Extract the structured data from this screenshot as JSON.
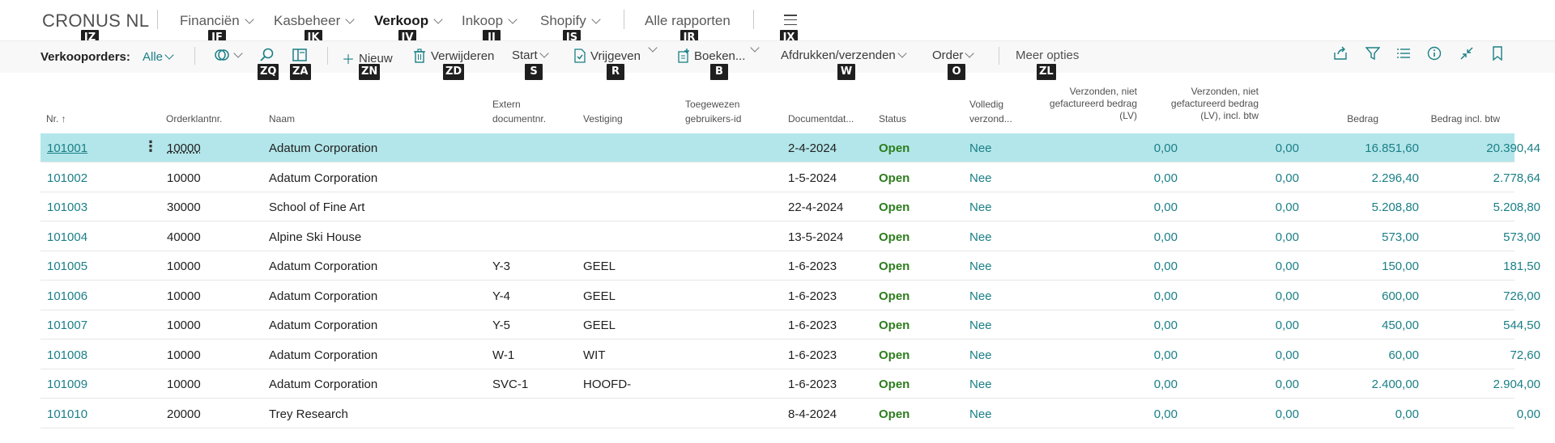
{
  "nav": {
    "company": "CRONUS NL",
    "items": [
      {
        "label": "Financiën",
        "chevron": true
      },
      {
        "label": "Kasbeheer",
        "chevron": true
      },
      {
        "label": "Verkoop",
        "chevron": true,
        "active": true
      },
      {
        "label": "Inkoop",
        "chevron": true
      },
      {
        "label": "Shopify",
        "chevron": true
      },
      {
        "label": "Alle rapporten",
        "chevron": false
      }
    ]
  },
  "keytips": {
    "company": "JZ",
    "financien": "JF",
    "kasbeheer": "JK",
    "verkoop": "JV",
    "inkoop": "JI",
    "shopify": "JS",
    "alle_rapporten": "JR",
    "menu": "JX",
    "search": "ZQ",
    "filter_pane": "ZA",
    "nieuw": "ZN",
    "verwijderen": "ZD",
    "start": "S",
    "vrijgeven": "R",
    "boeken": "B",
    "afdrukken": "W",
    "order": "O",
    "meer": "ZL"
  },
  "actions": {
    "page_title": "Verkooporders:",
    "view": "Alle",
    "nieuw": "Nieuw",
    "verwijderen": "Verwijderen",
    "start": "Start",
    "vrijgeven": "Vrijgeven",
    "boeken": "Boeken...",
    "afdrukken": "Afdrukken/verzenden",
    "order": "Order",
    "meer": "Meer opties"
  },
  "columns": {
    "nr": "Nr. ↑",
    "klant": "Orderklantnr.",
    "naam": "Naam",
    "extern": [
      "Extern",
      "documentnr."
    ],
    "vestiging": "Vestiging",
    "gebruiker": [
      "Toegewezen",
      "gebruikers-id"
    ],
    "datum": "Documentdat...",
    "status": "Status",
    "volledig": [
      "Volledig",
      "verzond..."
    ],
    "verzonden": [
      "Verzonden, niet",
      "gefactureerd bedrag",
      "(LV)"
    ],
    "verzonden_btw": [
      "Verzonden, niet",
      "gefactureerd bedrag",
      "(LV), incl. btw"
    ],
    "bedrag": "Bedrag",
    "bedrag_btw": "Bedrag incl. btw"
  },
  "rows": [
    {
      "nr": "101001",
      "klant": "10000",
      "naam": "Adatum Corporation",
      "extern": "",
      "vestiging": "",
      "datum": "2-4-2024",
      "status": "Open",
      "volledig": "Nee",
      "verz": "0,00",
      "verz_btw": "0,00",
      "bedrag": "16.851,60",
      "bedrag_btw": "20.390,44"
    },
    {
      "nr": "101002",
      "klant": "10000",
      "naam": "Adatum Corporation",
      "extern": "",
      "vestiging": "",
      "datum": "1-5-2024",
      "status": "Open",
      "volledig": "Nee",
      "verz": "0,00",
      "verz_btw": "0,00",
      "bedrag": "2.296,40",
      "bedrag_btw": "2.778,64"
    },
    {
      "nr": "101003",
      "klant": "30000",
      "naam": "School of Fine Art",
      "extern": "",
      "vestiging": "",
      "datum": "22-4-2024",
      "status": "Open",
      "volledig": "Nee",
      "verz": "0,00",
      "verz_btw": "0,00",
      "bedrag": "5.208,80",
      "bedrag_btw": "5.208,80"
    },
    {
      "nr": "101004",
      "klant": "40000",
      "naam": "Alpine Ski House",
      "extern": "",
      "vestiging": "",
      "datum": "13-5-2024",
      "status": "Open",
      "volledig": "Nee",
      "verz": "0,00",
      "verz_btw": "0,00",
      "bedrag": "573,00",
      "bedrag_btw": "573,00"
    },
    {
      "nr": "101005",
      "klant": "10000",
      "naam": "Adatum Corporation",
      "extern": "Y-3",
      "vestiging": "GEEL",
      "datum": "1-6-2023",
      "status": "Open",
      "volledig": "Nee",
      "verz": "0,00",
      "verz_btw": "0,00",
      "bedrag": "150,00",
      "bedrag_btw": "181,50"
    },
    {
      "nr": "101006",
      "klant": "10000",
      "naam": "Adatum Corporation",
      "extern": "Y-4",
      "vestiging": "GEEL",
      "datum": "1-6-2023",
      "status": "Open",
      "volledig": "Nee",
      "verz": "0,00",
      "verz_btw": "0,00",
      "bedrag": "600,00",
      "bedrag_btw": "726,00"
    },
    {
      "nr": "101007",
      "klant": "10000",
      "naam": "Adatum Corporation",
      "extern": "Y-5",
      "vestiging": "GEEL",
      "datum": "1-6-2023",
      "status": "Open",
      "volledig": "Nee",
      "verz": "0,00",
      "verz_btw": "0,00",
      "bedrag": "450,00",
      "bedrag_btw": "544,50"
    },
    {
      "nr": "101008",
      "klant": "10000",
      "naam": "Adatum Corporation",
      "extern": "W-1",
      "vestiging": "WIT",
      "datum": "1-6-2023",
      "status": "Open",
      "volledig": "Nee",
      "verz": "0,00",
      "verz_btw": "0,00",
      "bedrag": "60,00",
      "bedrag_btw": "72,60"
    },
    {
      "nr": "101009",
      "klant": "10000",
      "naam": "Adatum Corporation",
      "extern": "SVC-1",
      "vestiging": "HOOFD-",
      "datum": "1-6-2023",
      "status": "Open",
      "volledig": "Nee",
      "verz": "0,00",
      "verz_btw": "0,00",
      "bedrag": "2.400,00",
      "bedrag_btw": "2.904,00"
    },
    {
      "nr": "101010",
      "klant": "20000",
      "naam": "Trey Research",
      "extern": "",
      "vestiging": "",
      "datum": "8-4-2024",
      "status": "Open",
      "volledig": "Nee",
      "verz": "0,00",
      "verz_btw": "0,00",
      "bedrag": "0,00",
      "bedrag_btw": "0,00"
    }
  ],
  "colors": {
    "accent": "#1a7f86",
    "selected_row": "#b3e6ea",
    "status_open": "#2e7d1e"
  }
}
